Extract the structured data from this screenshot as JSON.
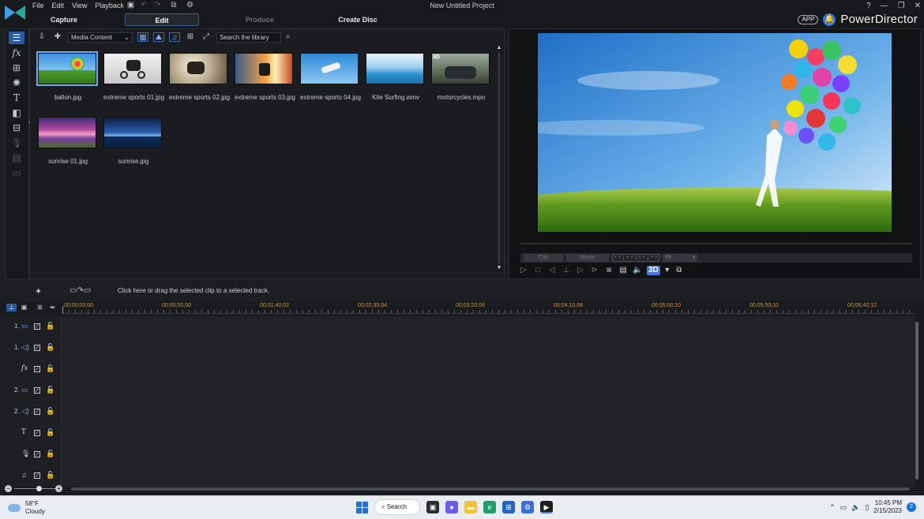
{
  "menu": [
    "File",
    "Edit",
    "View",
    "Playback"
  ],
  "project_title": "New Untitled Project",
  "window_controls": [
    "?",
    "—",
    "❐",
    "✕"
  ],
  "modes": [
    {
      "label": "Capture",
      "state": "normal"
    },
    {
      "label": "Edit",
      "state": "active"
    },
    {
      "label": "Produce",
      "state": "disabled"
    },
    {
      "label": "Create Disc",
      "state": "normal"
    }
  ],
  "brand": {
    "app_badge": "APP",
    "name": "PowerDirector"
  },
  "library": {
    "dropdown_value": "Media Content",
    "search_placeholder": "Search the library",
    "items": [
      {
        "name": "ballon.jpg",
        "selected": true
      },
      {
        "name": "extreme sports 01.jpg"
      },
      {
        "name": "extreme sports 02.jpg"
      },
      {
        "name": "extreme sports 03.jpg"
      },
      {
        "name": "extreme sports 04.jpg"
      },
      {
        "name": "Kite Surfing.wmv"
      },
      {
        "name": "motorcycles.mpo",
        "badge": "3D"
      },
      {
        "name": "sunrise 01.jpg"
      },
      {
        "name": "sunrise.jpg"
      }
    ]
  },
  "preview": {
    "clip_label": "Clip",
    "movie_label": "Movie",
    "timecode": "- - ; - - ; - - ; - -",
    "fit_label": "Fit",
    "btn_3d": "3D"
  },
  "hint": "Click here or drag the selected clip to a selected track.",
  "ruler_labels": [
    "00;00;00;00",
    "00;00;50;00",
    "00;01;40;02",
    "00;02;30;04",
    "00;03;20;06",
    "00;04;10;08",
    "00;05;00;10",
    "00;05;50;10",
    "00;06;40;12"
  ],
  "tracks": [
    {
      "label": "1.",
      "icon": "video"
    },
    {
      "label": "1.",
      "icon": "audio"
    },
    {
      "label": "",
      "icon": "fx"
    },
    {
      "label": "2.",
      "icon": "video"
    },
    {
      "label": "2.",
      "icon": "audio"
    },
    {
      "label": "",
      "icon": "title"
    },
    {
      "label": "",
      "icon": "voice"
    },
    {
      "label": "",
      "icon": "music"
    }
  ],
  "taskbar": {
    "temperature": "58°F",
    "condition": "Cloudy",
    "search_label": "Search",
    "time": "10:45 PM",
    "date": "2/15/2023",
    "notifications": "2"
  }
}
